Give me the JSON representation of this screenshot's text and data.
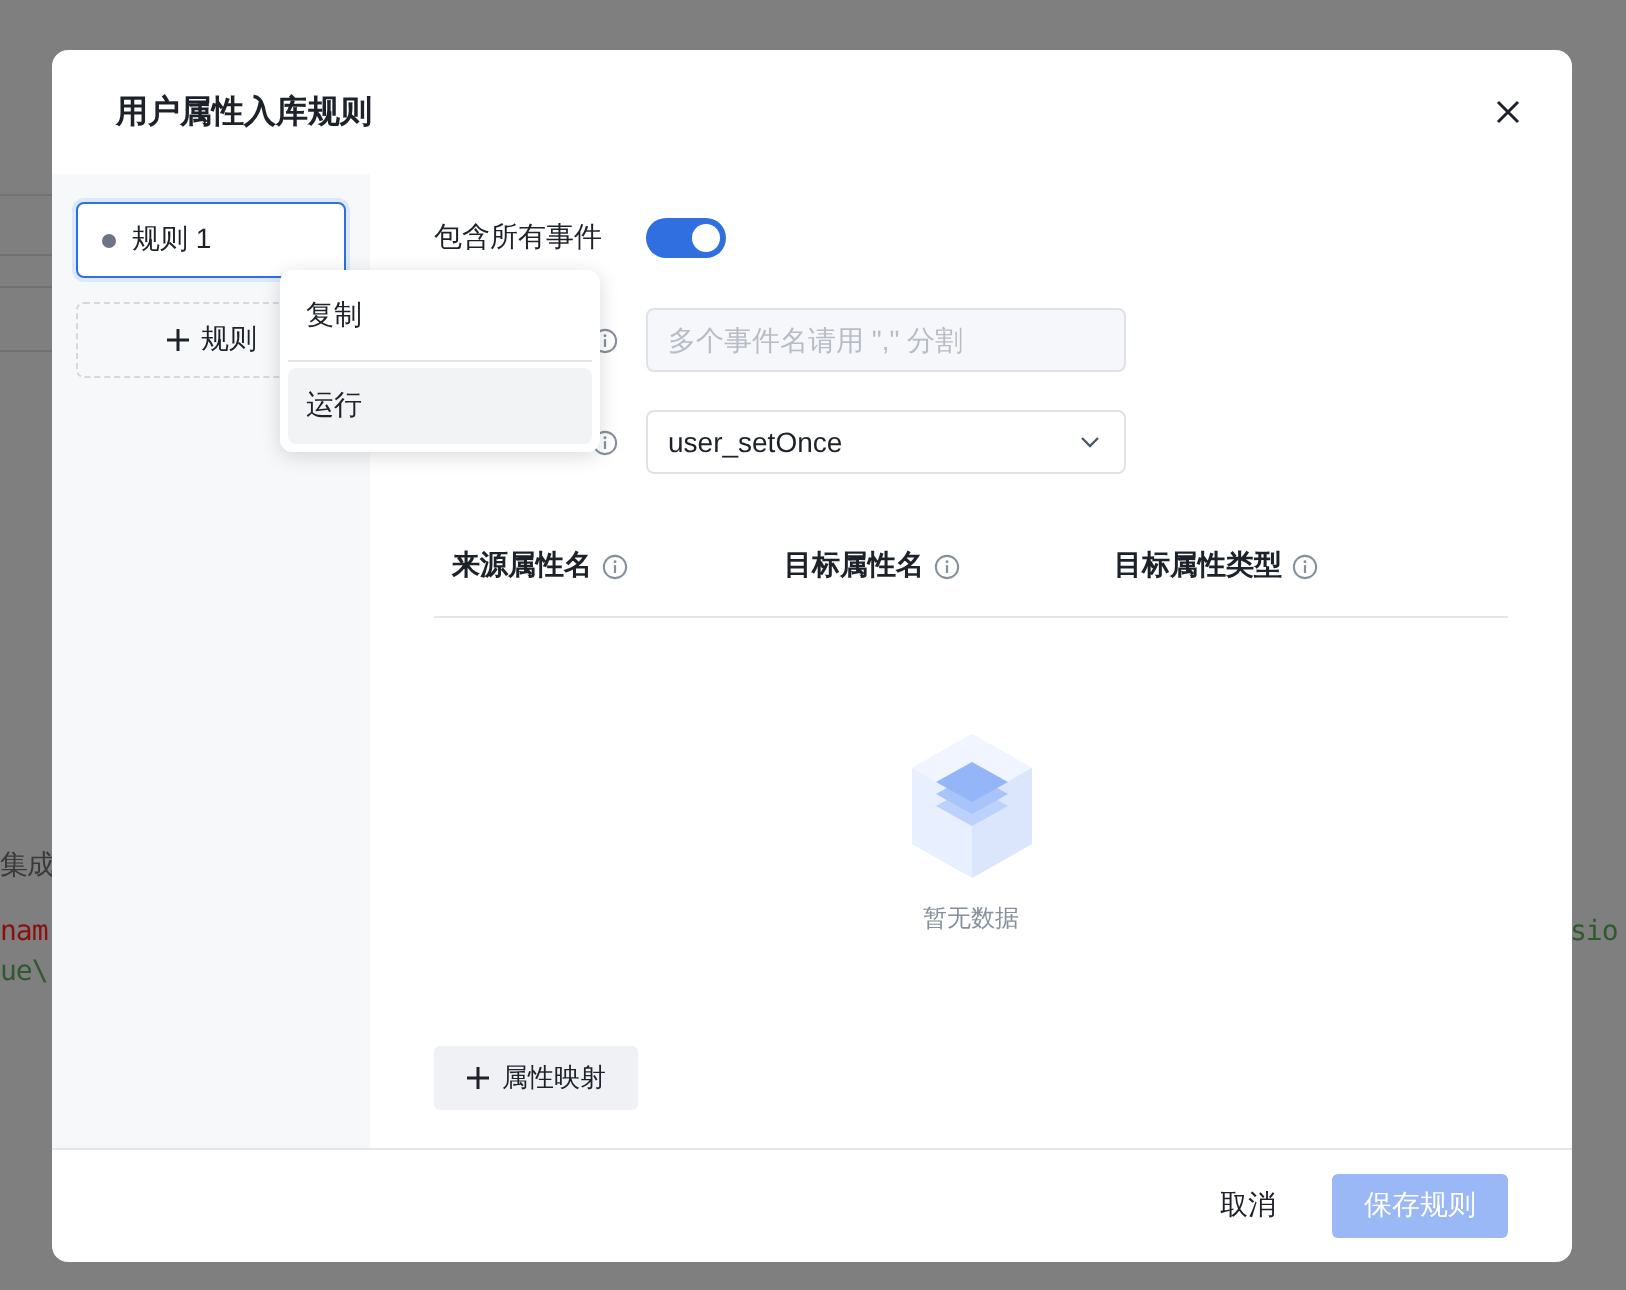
{
  "background": {
    "fragments": [
      {
        "text": "集成",
        "kind": "plain"
      },
      {
        "text": "nam",
        "kind": "keyword"
      },
      {
        "text": "ue\\",
        "kind": "string"
      },
      {
        "text": "sio",
        "kind": "string"
      }
    ]
  },
  "dialog": {
    "title": "用户属性入库规则",
    "rules": [
      {
        "label": "规则 1",
        "selected": true
      }
    ],
    "add_rule": "规则",
    "context_menu": [
      {
        "label": "复制",
        "selected": false
      },
      {
        "label": "运行",
        "selected": true
      }
    ],
    "form": {
      "include_all_events": {
        "label": "包含所有事件",
        "on": true
      },
      "event_field": {
        "placeholder": "多个事件名请用 \",\" 分割"
      },
      "operation_select": {
        "value": "user_setOnce"
      }
    },
    "table": {
      "columns": [
        "来源属性名",
        "目标属性名",
        "目标属性类型"
      ],
      "empty_text": "暂无数据"
    },
    "add_mapping": "属性映射",
    "footer": {
      "cancel": "取消",
      "save": {
        "label": "保存规则",
        "disabled": true
      }
    }
  }
}
